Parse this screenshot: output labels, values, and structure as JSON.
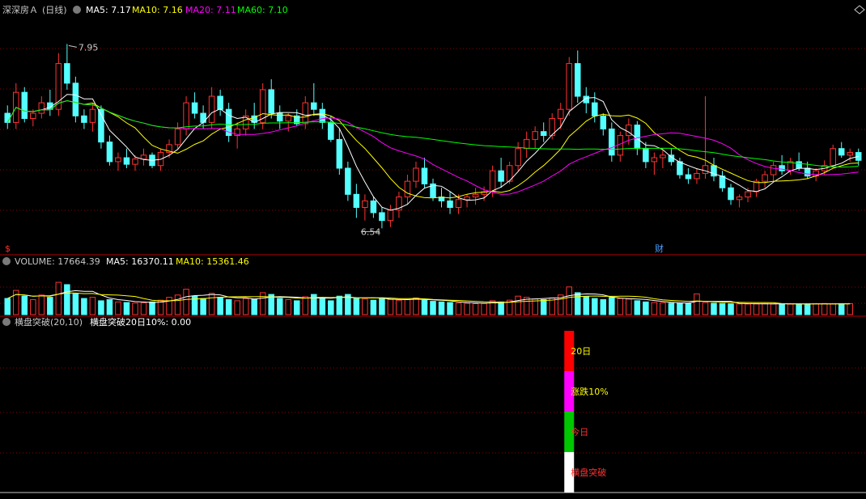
{
  "colors": {
    "bg": "#000000",
    "up": "#ff3232",
    "down": "#54ffff",
    "grid": "#8b0000",
    "ma5": "#ffffff",
    "ma10": "#ffff00",
    "ma20": "#ff00ff",
    "ma60": "#00ff00",
    "label_gray": "#c8c8c8",
    "breakout_red": "#ff0000",
    "breakout_magenta": "#ff00ff",
    "breakout_green": "#00c800",
    "breakout_white": "#ffffff"
  },
  "price_panel": {
    "stock_name": "深深房Ａ",
    "period": "(日线)",
    "ma5_label": "MA5: 7.17",
    "ma10_label": "MA10: 7.16",
    "ma20_label": "MA20: 7.11",
    "ma60_label": "MA60: 7.10",
    "high_marker": "7.95",
    "low_marker": "6.54",
    "s_marker": "$",
    "fin_marker": "财"
  },
  "volume_panel": {
    "title": "VOLUME: 17664.39",
    "ma5_label": "MA5: 16370.11",
    "ma10_label": "MA10: 15361.46"
  },
  "indicator_panel": {
    "title": "横盘突破(20,10)",
    "value_label": "横盘突破20日10%: 0.00",
    "seg_labels": [
      "20日",
      "涨跌10%",
      "今日",
      "横盘突破"
    ]
  },
  "chart_data": [
    {
      "type": "candlestick",
      "x_label": "",
      "y_label": "",
      "ylim": [
        6.4,
        8.15
      ],
      "series": [
        {
          "name": "MA5",
          "value": 7.17
        },
        {
          "name": "MA10",
          "value": 7.16
        },
        {
          "name": "MA20",
          "value": 7.11
        },
        {
          "name": "MA60",
          "value": 7.1
        }
      ],
      "annotations": [
        {
          "label": "7.95",
          "type": "high"
        },
        {
          "label": "6.54",
          "type": "low"
        }
      ],
      "ohlc": [
        [
          7.42,
          7.48,
          7.3,
          7.35
        ],
        [
          7.35,
          7.65,
          7.3,
          7.58
        ],
        [
          7.58,
          7.62,
          7.35,
          7.38
        ],
        [
          7.38,
          7.45,
          7.32,
          7.42
        ],
        [
          7.42,
          7.55,
          7.38,
          7.5
        ],
        [
          7.5,
          7.6,
          7.4,
          7.45
        ],
        [
          7.45,
          7.88,
          7.4,
          7.8
        ],
        [
          7.8,
          7.95,
          7.6,
          7.65
        ],
        [
          7.65,
          7.7,
          7.35,
          7.4
        ],
        [
          7.4,
          7.45,
          7.3,
          7.35
        ],
        [
          7.35,
          7.5,
          7.28,
          7.45
        ],
        [
          7.45,
          7.48,
          7.15,
          7.2
        ],
        [
          7.2,
          7.25,
          7.02,
          7.05
        ],
        [
          7.05,
          7.12,
          6.98,
          7.08
        ],
        [
          7.08,
          7.15,
          7.0,
          7.03
        ],
        [
          7.03,
          7.1,
          6.98,
          7.07
        ],
        [
          7.07,
          7.15,
          7.02,
          7.1
        ],
        [
          7.1,
          7.12,
          7.0,
          7.02
        ],
        [
          7.02,
          7.15,
          6.98,
          7.12
        ],
        [
          7.12,
          7.22,
          7.08,
          7.18
        ],
        [
          7.18,
          7.35,
          7.15,
          7.3
        ],
        [
          7.3,
          7.55,
          7.25,
          7.5
        ],
        [
          7.5,
          7.58,
          7.38,
          7.42
        ],
        [
          7.42,
          7.48,
          7.3,
          7.35
        ],
        [
          7.35,
          7.62,
          7.3,
          7.55
        ],
        [
          7.55,
          7.6,
          7.4,
          7.45
        ],
        [
          7.45,
          7.5,
          7.2,
          7.25
        ],
        [
          7.25,
          7.35,
          7.15,
          7.3
        ],
        [
          7.3,
          7.45,
          7.25,
          7.4
        ],
        [
          7.4,
          7.5,
          7.3,
          7.35
        ],
        [
          7.35,
          7.65,
          7.3,
          7.6
        ],
        [
          7.6,
          7.68,
          7.38,
          7.42
        ],
        [
          7.42,
          7.48,
          7.3,
          7.36
        ],
        [
          7.36,
          7.42,
          7.28,
          7.4
        ],
        [
          7.4,
          7.45,
          7.32,
          7.34
        ],
        [
          7.34,
          7.55,
          7.3,
          7.5
        ],
        [
          7.5,
          7.65,
          7.4,
          7.45
        ],
        [
          7.45,
          7.5,
          7.3,
          7.35
        ],
        [
          7.35,
          7.4,
          7.2,
          7.22
        ],
        [
          7.22,
          7.3,
          6.95,
          7.0
        ],
        [
          7.0,
          7.05,
          6.75,
          6.8
        ],
        [
          6.8,
          6.88,
          6.62,
          6.7
        ],
        [
          6.7,
          6.8,
          6.6,
          6.75
        ],
        [
          6.75,
          6.78,
          6.62,
          6.66
        ],
        [
          6.66,
          6.7,
          6.54,
          6.6
        ],
        [
          6.6,
          6.72,
          6.55,
          6.68
        ],
        [
          6.68,
          6.82,
          6.62,
          6.78
        ],
        [
          6.78,
          6.95,
          6.72,
          6.9
        ],
        [
          6.9,
          7.05,
          6.85,
          7.0
        ],
        [
          7.0,
          7.08,
          6.85,
          6.88
        ],
        [
          6.88,
          6.92,
          6.75,
          6.78
        ],
        [
          6.78,
          6.85,
          6.7,
          6.75
        ],
        [
          6.75,
          6.82,
          6.65,
          6.7
        ],
        [
          6.7,
          6.8,
          6.65,
          6.76
        ],
        [
          6.76,
          6.8,
          6.7,
          6.78
        ],
        [
          6.78,
          6.85,
          6.72,
          6.8
        ],
        [
          6.8,
          6.86,
          6.75,
          6.82
        ],
        [
          6.82,
          7.02,
          6.78,
          6.98
        ],
        [
          6.98,
          7.08,
          6.85,
          6.9
        ],
        [
          6.9,
          7.05,
          6.88,
          7.02
        ],
        [
          7.02,
          7.2,
          6.98,
          7.15
        ],
        [
          7.15,
          7.28,
          7.08,
          7.22
        ],
        [
          7.22,
          7.32,
          7.15,
          7.28
        ],
        [
          7.28,
          7.35,
          7.2,
          7.25
        ],
        [
          7.25,
          7.42,
          7.22,
          7.38
        ],
        [
          7.38,
          7.5,
          7.3,
          7.45
        ],
        [
          7.45,
          7.85,
          7.4,
          7.8
        ],
        [
          7.8,
          7.9,
          7.5,
          7.55
        ],
        [
          7.55,
          7.62,
          7.42,
          7.5
        ],
        [
          7.5,
          7.58,
          7.35,
          7.4
        ],
        [
          7.4,
          7.42,
          7.25,
          7.3
        ],
        [
          7.3,
          7.35,
          7.05,
          7.1
        ],
        [
          7.1,
          7.28,
          7.05,
          7.25
        ],
        [
          7.25,
          7.38,
          7.18,
          7.33
        ],
        [
          7.33,
          7.36,
          7.1,
          7.15
        ],
        [
          7.15,
          7.2,
          7.0,
          7.05
        ],
        [
          7.05,
          7.12,
          6.95,
          7.08
        ],
        [
          7.08,
          7.15,
          7.0,
          7.1
        ],
        [
          7.1,
          7.15,
          7.02,
          7.05
        ],
        [
          7.05,
          7.08,
          6.92,
          6.95
        ],
        [
          6.95,
          7.0,
          6.88,
          6.92
        ],
        [
          6.92,
          7.0,
          6.88,
          6.96
        ],
        [
          6.96,
          7.55,
          6.92,
          7.02
        ],
        [
          7.02,
          7.08,
          6.9,
          6.94
        ],
        [
          6.94,
          6.98,
          6.82,
          6.85
        ],
        [
          6.85,
          6.88,
          6.72,
          6.76
        ],
        [
          6.76,
          6.8,
          6.7,
          6.78
        ],
        [
          6.78,
          6.85,
          6.74,
          6.82
        ],
        [
          6.82,
          6.92,
          6.78,
          6.9
        ],
        [
          6.9,
          6.98,
          6.85,
          6.95
        ],
        [
          6.95,
          7.05,
          6.9,
          7.02
        ],
        [
          7.02,
          7.1,
          6.95,
          6.98
        ],
        [
          6.98,
          7.08,
          6.95,
          7.05
        ],
        [
          7.05,
          7.12,
          6.98,
          7.0
        ],
        [
          7.0,
          7.05,
          6.92,
          6.94
        ],
        [
          6.94,
          7.0,
          6.9,
          6.98
        ],
        [
          6.98,
          7.06,
          6.95,
          7.02
        ],
        [
          7.02,
          7.18,
          7.0,
          7.15
        ],
        [
          7.15,
          7.2,
          7.08,
          7.1
        ],
        [
          7.1,
          7.15,
          7.05,
          7.12
        ],
        [
          7.12,
          7.15,
          7.02,
          7.06
        ]
      ],
      "volume_ylim": [
        0,
        40000
      ],
      "volume": [
        14000,
        21000,
        16000,
        13000,
        17000,
        15000,
        28000,
        26000,
        18000,
        14000,
        15000,
        12000,
        13000,
        11000,
        10500,
        10000,
        10200,
        11000,
        12500,
        15000,
        17000,
        22000,
        16000,
        14000,
        18500,
        15000,
        13000,
        12000,
        14000,
        13500,
        19000,
        17500,
        14000,
        13000,
        12000,
        15500,
        17500,
        14000,
        12000,
        16000,
        17500,
        14000,
        13500,
        12500,
        14000,
        13000,
        12500,
        13000,
        14500,
        12500,
        11500,
        11000,
        10500,
        10000,
        9800,
        9500,
        9600,
        12000,
        11000,
        12500,
        16000,
        15000,
        13500,
        13000,
        14500,
        17000,
        24000,
        19000,
        15500,
        14000,
        13000,
        15000,
        14000,
        13500,
        12000,
        11000,
        10500,
        10200,
        9900,
        9700,
        9600,
        18000,
        10500,
        9900,
        9700,
        9400,
        9300,
        9200,
        9300,
        9500,
        9200,
        9300,
        9100,
        9200,
        9300,
        9400,
        9600,
        9200,
        9400,
        9500
      ],
      "breakout_signals": [
        {
          "index": 66,
          "value": 1.0
        }
      ]
    }
  ]
}
